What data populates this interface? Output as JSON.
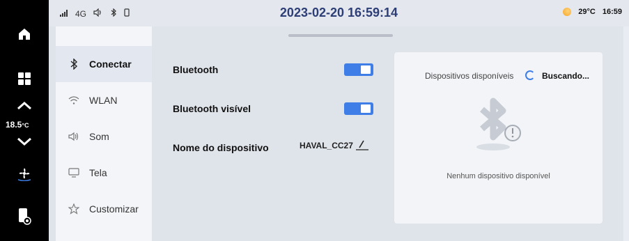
{
  "rail": {
    "temperature": "18.5",
    "temperature_unit": "°C",
    "icons": [
      "home-icon",
      "apps-grid-icon",
      "chevron-up-icon",
      "chevron-down-icon",
      "fan-icon",
      "phone-car-icon"
    ]
  },
  "statusbar": {
    "signal": "4G",
    "datetime": "2023-02-20 16:59:14",
    "weather_temp": "29°C",
    "clock": "16:59"
  },
  "menu": {
    "items": [
      {
        "label": "Conectar",
        "icon": "bluetooth-icon",
        "active": true
      },
      {
        "label": "WLAN",
        "icon": "wifi-icon",
        "active": false
      },
      {
        "label": "Som",
        "icon": "speaker-icon",
        "active": false
      },
      {
        "label": "Tela",
        "icon": "monitor-icon",
        "active": false
      },
      {
        "label": "Customizar",
        "icon": "star-icon",
        "active": false
      }
    ]
  },
  "settings": {
    "bluetooth_label": "Bluetooth",
    "bluetooth_on": true,
    "visible_label": "Bluetooth visível",
    "visible_on": true,
    "name_label": "Nome do dispositivo",
    "device_name": "HAVAL_CC27"
  },
  "devices": {
    "header": "Dispositivos disponíveis",
    "status": "Buscando...",
    "empty": "Nenhum dispositivo disponível"
  },
  "colors": {
    "accent": "#3e7ee6",
    "rail": "#000000",
    "panel": "#dfe3ea"
  }
}
